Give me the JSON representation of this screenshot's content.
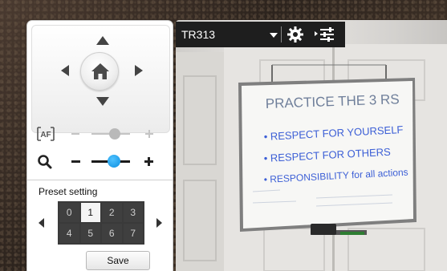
{
  "ptz": {
    "icons": {
      "up": "triangle-up",
      "down": "triangle-down",
      "left": "triangle-left",
      "right": "triangle-right",
      "home": "house-icon"
    }
  },
  "focus": {
    "icon_label": "[AF]",
    "level": 0.5
  },
  "zoom": {
    "icon": "magnifier-icon",
    "level": 0.5
  },
  "presets": {
    "title": "Preset setting",
    "slots": [
      "0",
      "1",
      "2",
      "3",
      "4",
      "5",
      "6",
      "7"
    ],
    "selected": "1",
    "save_label": "Save"
  },
  "video": {
    "camera_name": "TR313",
    "icons": {
      "dropdown": "caret-down-icon",
      "settings": "gear-icon",
      "adjust": "sliders-icon"
    },
    "whiteboard_text": [
      "PRACTICE THE 3 RS",
      "• RESPECT FOR YOURSELF",
      "• RESPECT FOR OTHERS",
      "• RESPONSIBILITY for all actions"
    ]
  },
  "colors": {
    "accent": "#1296e8",
    "toolbar_bg": "#1e1e1e",
    "panel_bg": "#ffffff"
  }
}
